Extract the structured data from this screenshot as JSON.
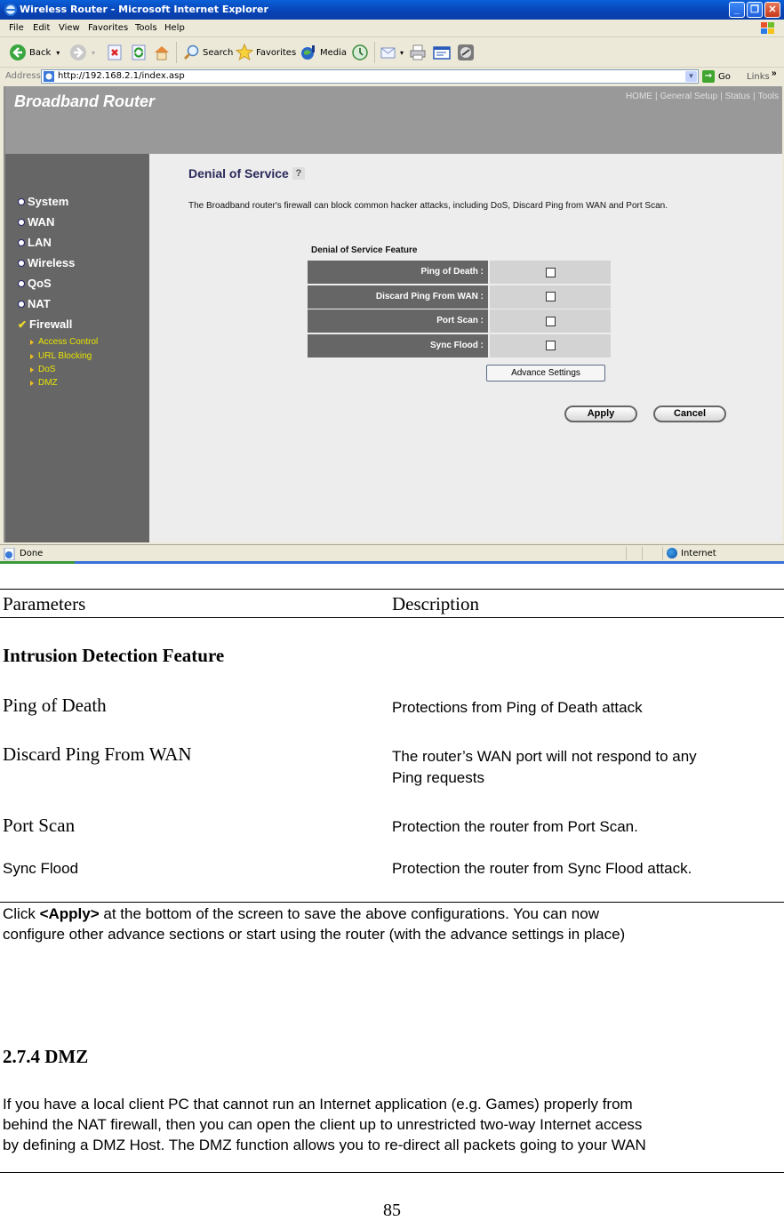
{
  "browser": {
    "window_title": "Wireless Router - Microsoft Internet Explorer",
    "menu": [
      "File",
      "Edit",
      "View",
      "Favorites",
      "Tools",
      "Help"
    ],
    "toolbar": {
      "back": "Back",
      "search": "Search",
      "favorites": "Favorites",
      "media": "Media"
    },
    "address_label": "Address",
    "address_url": "http://192.168.2.1/index.asp",
    "go_label": "Go",
    "links_label": "Links",
    "links_chevron": "»",
    "status_text": "Done",
    "zone_text": "Internet",
    "window_buttons": {
      "minimize": "_",
      "restore": "❐",
      "close": "✕"
    }
  },
  "router": {
    "brand": "Broadband Router",
    "top_nav": [
      "HOME",
      "General Setup",
      "Status",
      "Tools"
    ],
    "top_nav_separator": "|",
    "sidebar": [
      {
        "label": "System"
      },
      {
        "label": "WAN"
      },
      {
        "label": "LAN"
      },
      {
        "label": "Wireless"
      },
      {
        "label": "QoS"
      },
      {
        "label": "NAT"
      },
      {
        "label": "Firewall",
        "active": true
      }
    ],
    "sidebar_sub": [
      "Access Control",
      "URL Blocking",
      "DoS",
      "DMZ"
    ],
    "page_title": "Denial of Service",
    "help_glyph": "?",
    "description": "The Broadband router's firewall can block common hacker attacks, including DoS, Discard Ping from WAN and Port Scan.",
    "feature_heading": "Denial of Service Feature",
    "features": [
      {
        "label": "Ping of Death :",
        "checked": false
      },
      {
        "label": "Discard Ping From WAN :",
        "checked": false
      },
      {
        "label": "Port Scan :",
        "checked": false
      },
      {
        "label": "Sync Flood :",
        "checked": false
      }
    ],
    "advance_button": "Advance Settings",
    "apply_button": "Apply",
    "cancel_button": "Cancel"
  },
  "doc": {
    "table_header": {
      "left": "Parameters",
      "right": "Description"
    },
    "section_heading": "Intrusion Detection Feature",
    "rows": [
      {
        "param": "Ping of Death",
        "desc": "Protections from Ping of Death attack"
      },
      {
        "param": "Discard Ping From WAN",
        "desc": "The router’s WAN port will not respond to any",
        "desc2": "Ping requests"
      },
      {
        "param": "Port Scan",
        "desc": "Protection the router from Port Scan."
      },
      {
        "param": "Sync Flood",
        "desc": "Protection the router from Sync Flood attack."
      }
    ],
    "apply_note": {
      "prefix": "Click ",
      "bold": "<Apply>",
      "line1_rest": " at the bottom of the screen to save the above configurations. You can now",
      "line2": "configure other advance sections or start using the router (with the advance settings in place)"
    },
    "dmz_heading": "2.7.4 DMZ",
    "dmz_lines": [
      "If you have a local client PC that cannot run an Internet application (e.g. Games) properly from",
      "behind the NAT firewall, then you can open the client up to unrestricted two-way Internet access",
      "by defining a DMZ Host. The DMZ function allows you to re-direct all packets going to your WAN"
    ],
    "page_number": "85"
  }
}
